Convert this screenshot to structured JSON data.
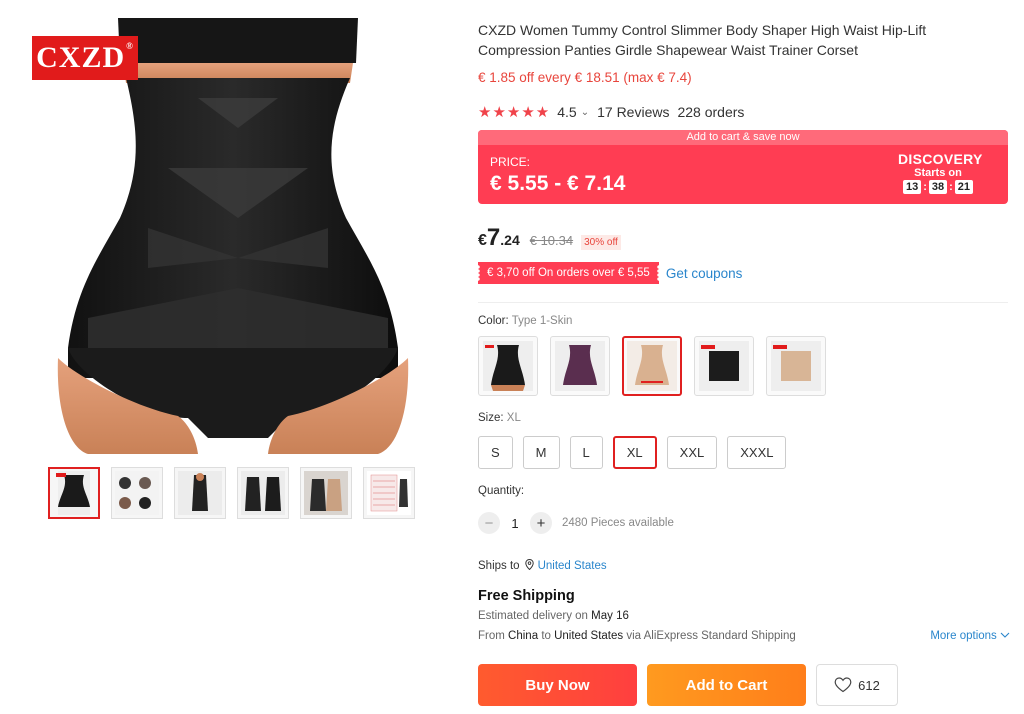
{
  "gallery": {
    "brand_logo": "CXZD",
    "brand_mark": "®",
    "thumbnail_count": 6
  },
  "product": {
    "title": "CXZD Women Tummy Control Slimmer Body Shaper High Waist Hip-Lift Compression Panties Girdle Shapewear Waist Trainer Corset",
    "coupon_line": "€ 1.85 off every € 18.51 (max € 7.4)",
    "rating": {
      "stars": "★★★★★",
      "score": "4.5",
      "caret": "⌄",
      "reviews": "17 Reviews",
      "orders": "228 orders"
    }
  },
  "promo": {
    "header": "Add to cart & save now",
    "price_label": "PRICE:",
    "price_range": "€ 5.55 - € 7.14",
    "discovery": "DISCOVERY",
    "starts_on": "Starts on",
    "countdown": [
      "13",
      "38",
      "21"
    ],
    "colors": {
      "bg": "#ff3d53",
      "header_bg": "#ff6a7a"
    }
  },
  "price": {
    "currency": "€",
    "integer": "7",
    "decimal": ".24",
    "original": "€ 10.34",
    "discount": "30% off"
  },
  "store_coupon": {
    "label": "€ 3,70 off On orders over € 5,55",
    "get_coupons": "Get coupons"
  },
  "color": {
    "label": "Color:",
    "selected": "Type 1-Skin",
    "options": [
      "Type 1-Black",
      "Type 1-Purple",
      "Type 1-Skin",
      "Type 2-Black",
      "Type 2-Skin"
    ],
    "selected_index": 2
  },
  "size": {
    "label": "Size:",
    "selected": "XL",
    "options": [
      "S",
      "M",
      "L",
      "XL",
      "XXL",
      "XXXL"
    ]
  },
  "quantity": {
    "label": "Quantity:",
    "minus": "−",
    "plus": "+",
    "value": "1",
    "available": "2480 Pieces available"
  },
  "shipping": {
    "ships_to_label": "Ships to",
    "country": "United States",
    "free_shipping": "Free Shipping",
    "est_prefix": "Estimated delivery on",
    "est_date": "May 16",
    "from_word": "From",
    "from_country": "China",
    "to_word": "to",
    "to_country": "United States",
    "via_text": "via AliExpress Standard Shipping",
    "more_options": "More options"
  },
  "actions": {
    "buy_now": "Buy Now",
    "add_to_cart": "Add to Cart",
    "wishlist_count": "612"
  },
  "theme": {
    "accent_red": "#e02020",
    "link_blue": "#2a86cc",
    "buy_orange": "#ff5b2e",
    "cart_orange": "#ff9a1f"
  }
}
